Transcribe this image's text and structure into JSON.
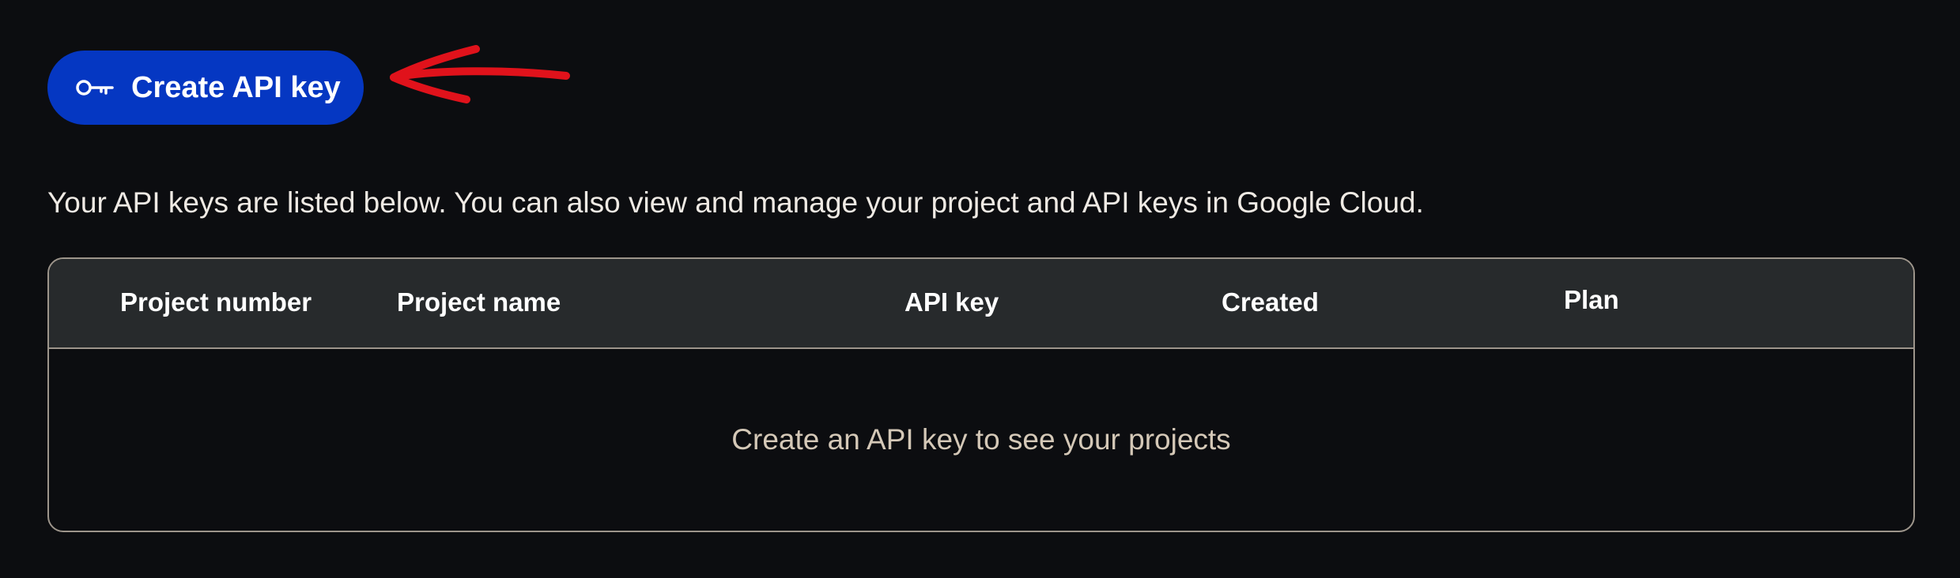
{
  "create_button": {
    "label": "Create API key",
    "icon": "key-icon"
  },
  "intro_text": "Your API keys are listed below. You can also view and manage your project and API keys in Google Cloud.",
  "table": {
    "columns": [
      "Project number",
      "Project name",
      "API key",
      "Created",
      "Plan"
    ],
    "empty_message": "Create an API key to see your projects"
  },
  "colors": {
    "background": "#0c0d10",
    "button": "#0537c2",
    "table_header": "#272a2c",
    "border": "#9d958b",
    "annotation": "#e0121b"
  }
}
